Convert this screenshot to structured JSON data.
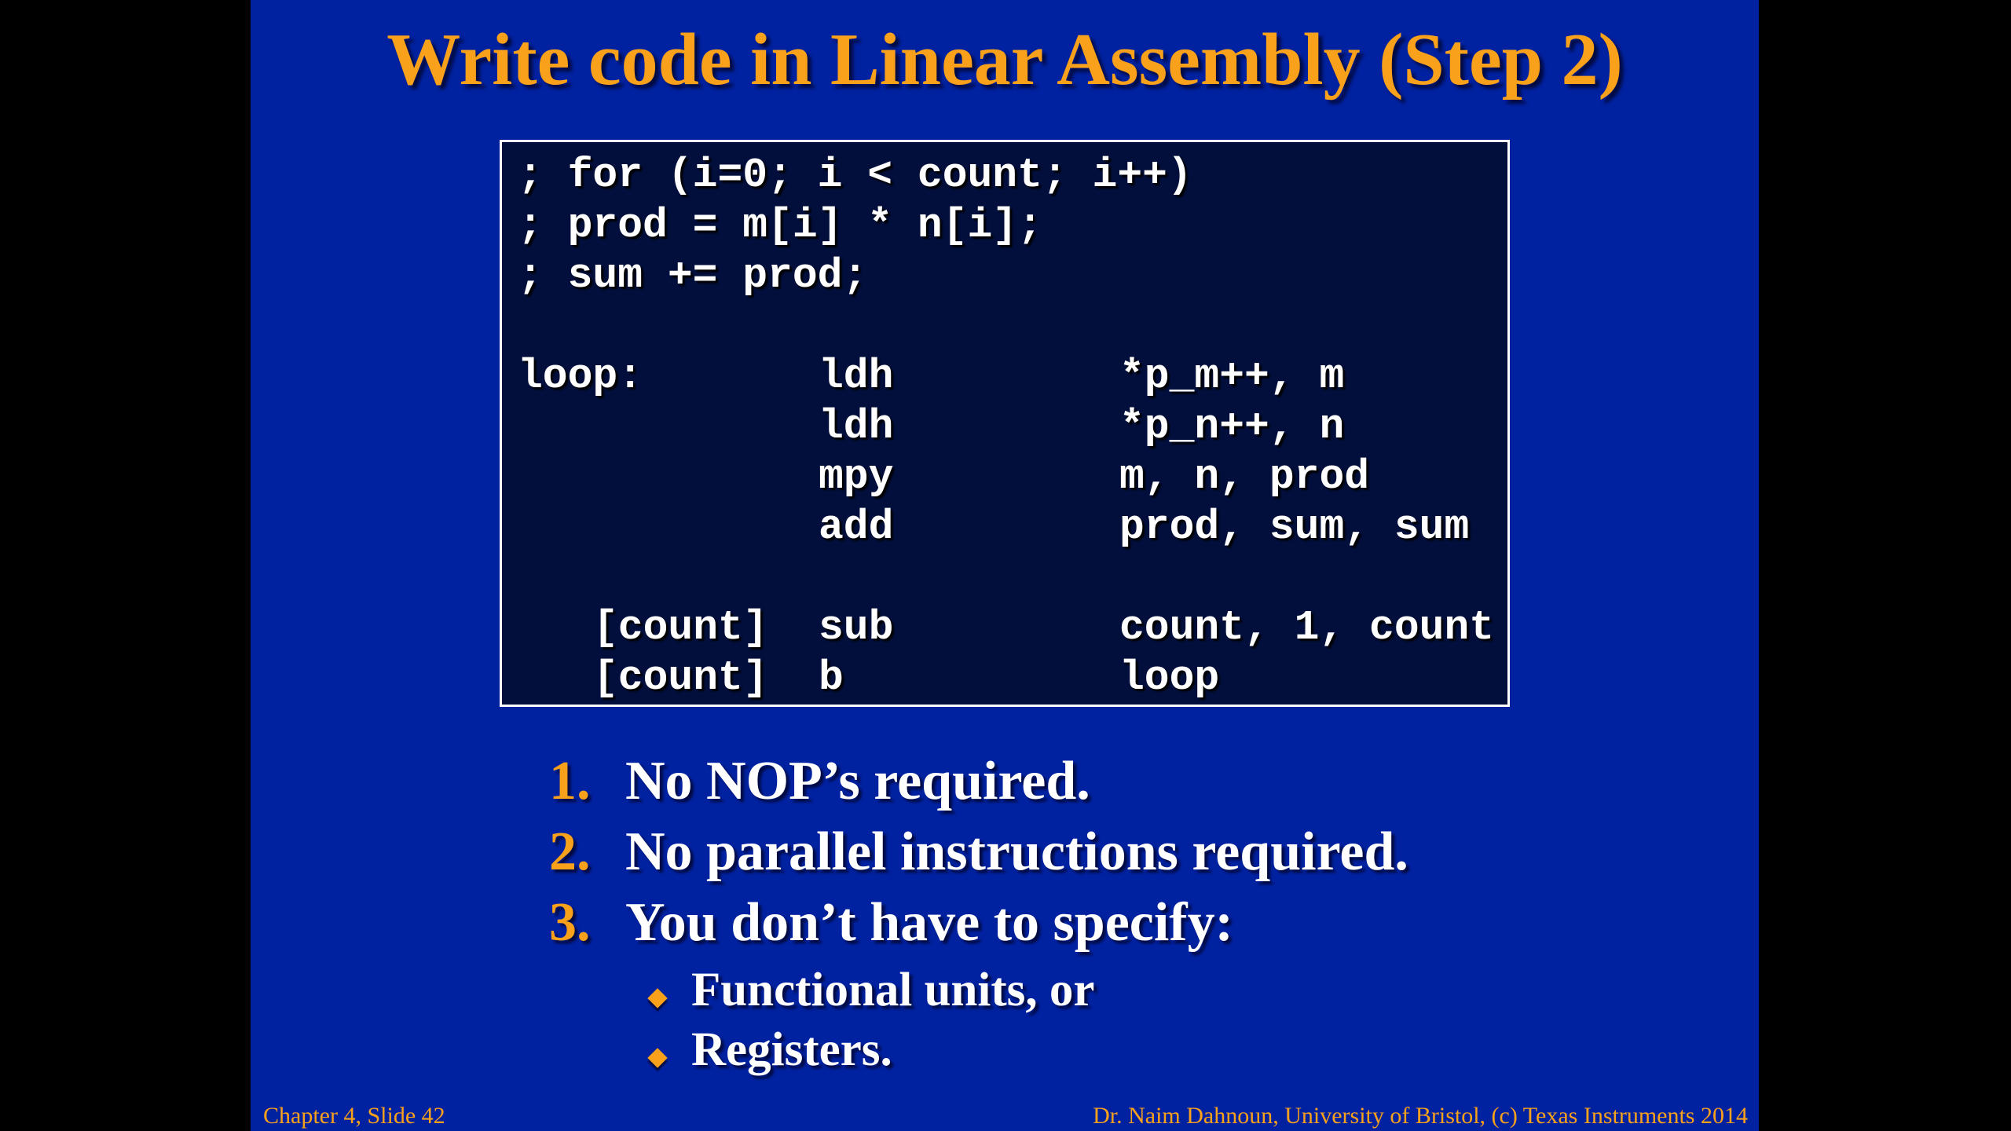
{
  "title": "Write code in Linear Assembly (Step 2)",
  "code": {
    "comment_1": "; for (i=0; i < count; i++)",
    "comment_2": "; prod = m[i] * n[i];",
    "comment_3": "; sum += prod;",
    "rows": [
      {
        "label": "loop:",
        "op": "ldh",
        "args": "*p_m++, m"
      },
      {
        "label": "",
        "op": "ldh",
        "args": "*p_n++, n"
      },
      {
        "label": "",
        "op": "mpy",
        "args": "m, n, prod"
      },
      {
        "label": "",
        "op": "add",
        "args": "prod, sum, sum"
      },
      {
        "label": "[count]",
        "op": "sub",
        "args": "count, 1, count"
      },
      {
        "label": "[count]",
        "op": "b",
        "args": "loop"
      }
    ]
  },
  "points": [
    {
      "num": "1.",
      "text": "No NOP’s required."
    },
    {
      "num": "2.",
      "text": "No parallel instructions required."
    },
    {
      "num": "3.",
      "text": "You don’t have to specify:"
    }
  ],
  "subpoints": [
    "Functional units, or",
    "Registers."
  ],
  "footer": {
    "left": "Chapter 4, Slide 42",
    "right": "Dr. Naim Dahnoun, University of Bristol,  (c) Texas Instruments 2014"
  },
  "colors": {
    "background": "#0022a0",
    "accent": "#f9a11b",
    "code_background": "#020f3c"
  }
}
